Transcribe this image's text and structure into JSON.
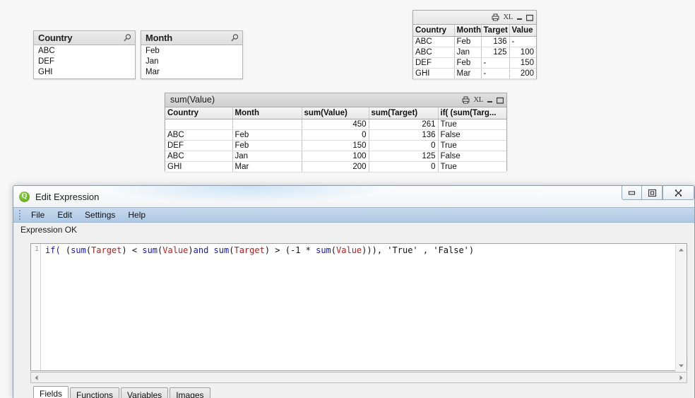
{
  "listboxes": [
    {
      "title": "Country",
      "search_icon": "magnifier-icon",
      "items": [
        "ABC",
        "DEF",
        "GHI"
      ]
    },
    {
      "title": "Month",
      "search_icon": "magnifier-icon",
      "items": [
        "Feb",
        "Jan",
        "Mar"
      ]
    }
  ],
  "source_table": {
    "caption_title": "",
    "caption_icons": [
      "print-icon",
      "XL",
      "minimize-icon",
      "maximize-icon"
    ],
    "xl_label": "XL",
    "columns": [
      "Country",
      "Month",
      "Target",
      "Value"
    ],
    "sorted_column": "Country",
    "rows": [
      [
        "ABC",
        "Feb",
        "136",
        "-"
      ],
      [
        "ABC",
        "Jan",
        "125",
        "100"
      ],
      [
        "DEF",
        "Feb",
        "-",
        "150"
      ],
      [
        "GHI",
        "Mar",
        "-",
        "200"
      ]
    ]
  },
  "pivot_table": {
    "caption_title": "sum(Value)",
    "caption_icons": [
      "print-icon",
      "XL",
      "minimize-icon",
      "maximize-icon"
    ],
    "xl_label": "XL",
    "columns": [
      "Country",
      "Month",
      "sum(Value)",
      "sum(Target)",
      "if( (sum(Targ..."
    ],
    "sorted_column": "Month",
    "total_row": [
      "",
      "",
      "450",
      "261",
      "True"
    ],
    "rows": [
      [
        "ABC",
        "Feb",
        "0",
        "136",
        "False"
      ],
      [
        "DEF",
        "Feb",
        "150",
        "0",
        "True"
      ],
      [
        "ABC",
        "Jan",
        "100",
        "125",
        "False"
      ],
      [
        "GHI",
        "Mar",
        "200",
        "0",
        "True"
      ]
    ]
  },
  "dialog": {
    "title": "Edit Expression",
    "logo": "qlikview-logo-icon",
    "window_buttons": [
      "minimize-icon",
      "restore-icon",
      "close-icon"
    ],
    "menu": [
      "File",
      "Edit",
      "Settings",
      "Help"
    ],
    "status": "Expression OK",
    "line_number": "1",
    "expression": "if( (sum(Target) < sum(Value) and sum(Target) > (-1 * sum(Value))), 'True' , 'False')",
    "expression_tokens": [
      {
        "t": "if(",
        "k": "fn"
      },
      {
        "t": " (",
        "k": "op"
      },
      {
        "t": "sum",
        "k": "fn"
      },
      {
        "t": "(",
        "k": "op"
      },
      {
        "t": "Target",
        "k": "field"
      },
      {
        "t": ")",
        "k": "op"
      },
      {
        "t": " < ",
        "k": "op"
      },
      {
        "t": "sum",
        "k": "fn"
      },
      {
        "t": "(",
        "k": "op"
      },
      {
        "t": "Value",
        "k": "field"
      },
      {
        "t": ")",
        "k": "op"
      },
      {
        "t": "and",
        "k": "fn"
      },
      {
        "t": " ",
        "k": "op"
      },
      {
        "t": "sum",
        "k": "fn"
      },
      {
        "t": "(",
        "k": "op"
      },
      {
        "t": "Target",
        "k": "field"
      },
      {
        "t": ")",
        "k": "op"
      },
      {
        "t": " > (",
        "k": "op"
      },
      {
        "t": "-1",
        "k": "op"
      },
      {
        "t": " * ",
        "k": "op"
      },
      {
        "t": "sum",
        "k": "fn"
      },
      {
        "t": "(",
        "k": "op"
      },
      {
        "t": "Value",
        "k": "field"
      },
      {
        "t": ")))",
        "k": "op"
      },
      {
        "t": ", 'True' , 'False')",
        "k": "str"
      }
    ],
    "tabs": [
      {
        "label": "Fields",
        "active": true
      },
      {
        "label": "Functions",
        "active": false
      },
      {
        "label": "Variables",
        "active": false
      },
      {
        "label": "Images",
        "active": false
      }
    ]
  }
}
